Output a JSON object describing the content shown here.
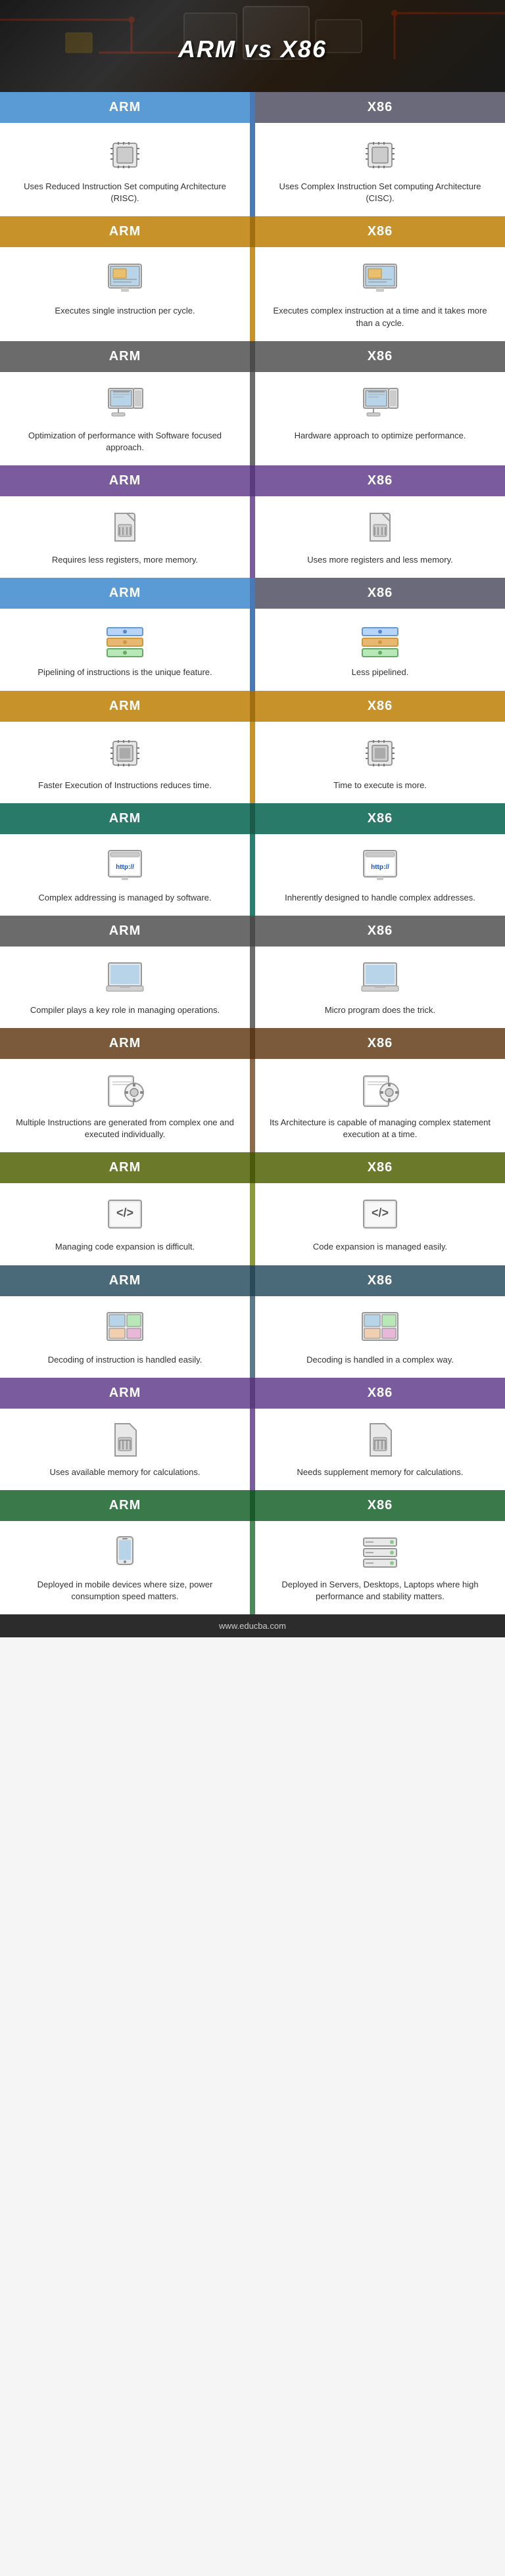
{
  "header": {
    "title": "ARM vs X86",
    "bg_desc": "circuit board background"
  },
  "sections": [
    {
      "id": 1,
      "bar_color": "blue",
      "divider_color": "blue",
      "arm_label": "ARM",
      "x86_label": "X86",
      "arm_icon": "chip",
      "x86_icon": "chip",
      "arm_text": "Uses Reduced Instruction Set computing Architecture (RISC).",
      "x86_text": "Uses Complex Instruction Set computing Architecture (CISC)."
    },
    {
      "id": 2,
      "bar_color": "gold",
      "divider_color": "gold",
      "arm_label": "ARM",
      "x86_label": "X86",
      "arm_icon": "monitor-doc",
      "x86_icon": "monitor-doc",
      "arm_text": "Executes single instruction per cycle.",
      "x86_text": "Executes complex instruction at a time and it takes more than a cycle."
    },
    {
      "id": 3,
      "bar_color": "gray",
      "divider_color": "gray",
      "arm_label": "ARM",
      "x86_label": "X86",
      "arm_icon": "desktop",
      "x86_icon": "desktop",
      "arm_text": "Optimization of performance with Software focused approach.",
      "x86_text": "Hardware approach to optimize performance."
    },
    {
      "id": 4,
      "bar_color": "purple",
      "divider_color": "purple",
      "arm_label": "ARM",
      "x86_label": "X86",
      "arm_icon": "sim-card",
      "x86_icon": "sim-card",
      "arm_text": "Requires less registers, more memory.",
      "x86_text": "Uses more registers and less memory."
    },
    {
      "id": 5,
      "bar_color": "blue",
      "divider_color": "blue",
      "arm_label": "ARM",
      "x86_label": "X86",
      "arm_icon": "pipeline",
      "x86_icon": "pipeline",
      "arm_text": "Pipelining of instructions is the unique feature.",
      "x86_text": "Less pipelined."
    },
    {
      "id": 6,
      "bar_color": "gold",
      "divider_color": "gold",
      "arm_label": "ARM",
      "x86_label": "X86",
      "arm_icon": "chip2",
      "x86_icon": "chip2",
      "arm_text": "Faster Execution of Instructions reduces time.",
      "x86_text": "Time to execute is more."
    },
    {
      "id": 7,
      "bar_color": "teal",
      "divider_color": "teal",
      "arm_label": "ARM",
      "x86_label": "X86",
      "arm_icon": "http",
      "x86_icon": "http",
      "arm_text": "Complex addressing is managed by software.",
      "x86_text": "Inherently designed to handle complex addresses."
    },
    {
      "id": 8,
      "bar_color": "gray",
      "divider_color": "gray",
      "arm_label": "ARM",
      "x86_label": "X86",
      "arm_icon": "laptop",
      "x86_icon": "laptop",
      "arm_text": "Compiler plays a key role in managing operations.",
      "x86_text": "Micro program does the trick."
    },
    {
      "id": 9,
      "bar_color": "brown",
      "divider_color": "brown",
      "arm_label": "ARM",
      "x86_label": "X86",
      "arm_icon": "gear-doc",
      "x86_icon": "gear-doc",
      "arm_text": "Multiple Instructions are generated from complex one and executed individually.",
      "x86_text": "Its Architecture is capable of managing complex statement execution at a time."
    },
    {
      "id": 10,
      "bar_color": "olive",
      "divider_color": "olive",
      "arm_label": "ARM",
      "x86_label": "X86",
      "arm_icon": "code",
      "x86_icon": "code",
      "arm_text": "Managing code expansion is difficult.",
      "x86_text": "Code expansion is managed easily."
    },
    {
      "id": 11,
      "bar_color": "slate",
      "divider_color": "slate",
      "arm_label": "ARM",
      "x86_label": "X86",
      "arm_icon": "windows",
      "x86_icon": "windows",
      "arm_text": "Decoding of instruction is handled easily.",
      "x86_text": "Decoding is handled in a complex way."
    },
    {
      "id": 12,
      "bar_color": "purple",
      "divider_color": "purple",
      "arm_label": "ARM",
      "x86_label": "X86",
      "arm_icon": "simcard2",
      "x86_icon": "simcard2",
      "arm_text": "Uses available memory for calculations.",
      "x86_text": "Needs supplement memory for calculations."
    },
    {
      "id": 13,
      "bar_color": "green",
      "divider_color": "green",
      "arm_label": "ARM",
      "x86_label": "X86",
      "arm_icon": "mobile",
      "x86_icon": "server",
      "arm_text": "Deployed in mobile devices where size, power consumption speed matters.",
      "x86_text": "Deployed in Servers, Desktops, Laptops where high performance and stability matters."
    }
  ],
  "footer": {
    "url": "www.educba.com"
  }
}
